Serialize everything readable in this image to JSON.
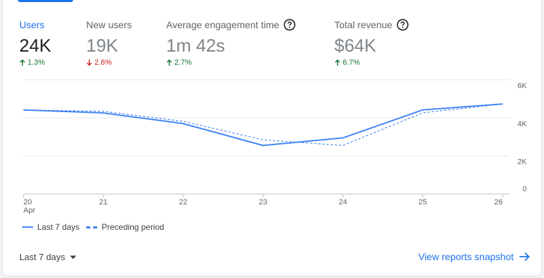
{
  "metrics": [
    {
      "label": "Users",
      "value": "24K",
      "delta": "1.3%",
      "direction": "up",
      "help": false,
      "active": true
    },
    {
      "label": "New users",
      "value": "19K",
      "delta": "2.6%",
      "direction": "down",
      "help": false,
      "active": false
    },
    {
      "label": "Average engagement time",
      "value": "1m 42s",
      "delta": "2.7%",
      "direction": "up",
      "help": true,
      "active": false
    },
    {
      "label": "Total revenue",
      "value": "$64K",
      "delta": "6.7%",
      "direction": "up",
      "help": true,
      "active": false
    }
  ],
  "legend": {
    "current": "Last 7 days",
    "previous": "Preceding period"
  },
  "footer": {
    "range_label": "Last 7 days",
    "snapshot_link": "View reports snapshot"
  },
  "icons": {
    "up": "arrow-up-icon",
    "down": "arrow-down-icon",
    "help": "help-circle-icon",
    "dropdown": "caret-down-icon",
    "link": "arrow-right-icon"
  },
  "colors": {
    "accent": "#1a73e8",
    "series": "#4285f4",
    "up": "#137333",
    "down": "#c5221f"
  },
  "chart_data": {
    "type": "line",
    "x": [
      "20",
      "21",
      "22",
      "23",
      "24",
      "25",
      "26"
    ],
    "x_sublabel": "Apr",
    "y_ticks": [
      "0",
      "2K",
      "4K",
      "6K"
    ],
    "ylim": [
      0,
      6000
    ],
    "grid": true,
    "legend_position": "bottom-left",
    "series": [
      {
        "name": "Last 7 days",
        "values": [
          4420,
          4260,
          3700,
          2550,
          2950,
          4420,
          4730
        ],
        "style": "solid"
      },
      {
        "name": "Preceding period",
        "values": [
          4420,
          4350,
          3820,
          2850,
          2550,
          4270,
          4730
        ],
        "style": "dashed"
      }
    ]
  }
}
